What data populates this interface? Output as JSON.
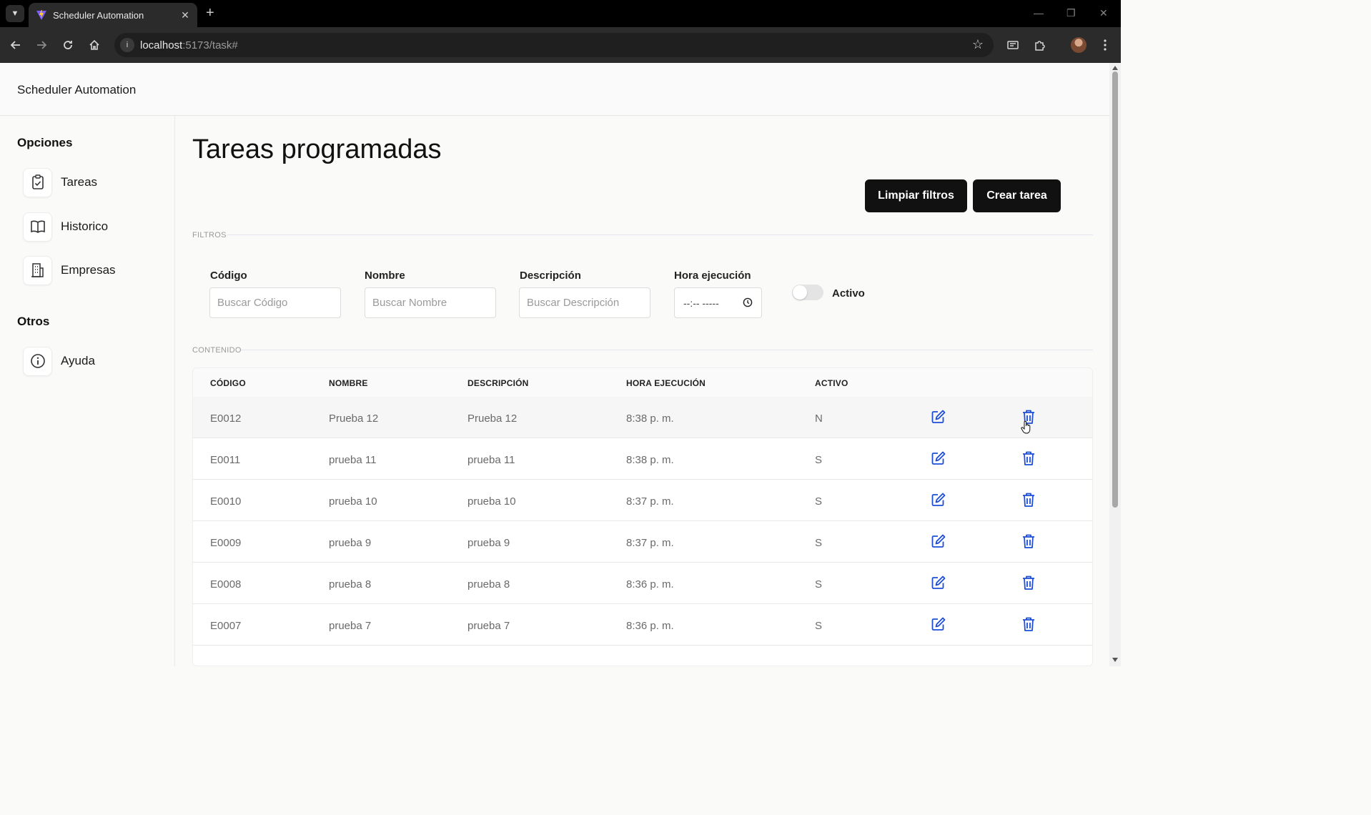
{
  "browser": {
    "tab_title": "Scheduler Automation",
    "url_host": "localhost",
    "url_rest": ":5173/task#"
  },
  "app": {
    "brand": "Scheduler Automation"
  },
  "sidebar": {
    "heading_options": "Opciones",
    "items": [
      {
        "label": "Tareas",
        "icon": "clipboard-check-icon"
      },
      {
        "label": "Historico",
        "icon": "book-icon"
      },
      {
        "label": "Empresas",
        "icon": "building-icon"
      }
    ],
    "heading_other": "Otros",
    "other_items": [
      {
        "label": "Ayuda",
        "icon": "info-icon"
      }
    ]
  },
  "main": {
    "title": "Tareas programadas",
    "clear_filters_label": "Limpiar filtros",
    "create_task_label": "Crear tarea",
    "filters_section": "FILTROS",
    "content_section": "CONTENIDO"
  },
  "filters": {
    "code_label": "Código",
    "code_placeholder": "Buscar Código",
    "name_label": "Nombre",
    "name_placeholder": "Buscar Nombre",
    "desc_label": "Descripción",
    "desc_placeholder": "Buscar Descripción",
    "time_label": "Hora ejecución",
    "time_value": "--:-- -----",
    "active_label": "Activo",
    "active_on": false
  },
  "table": {
    "headers": [
      "CÓDIGO",
      "NOMBRE",
      "DESCRIPCIÓN",
      "HORA EJECUCIÓN",
      "ACTIVO"
    ],
    "rows": [
      [
        "E0012",
        "Prueba 12",
        "Prueba 12",
        "8:38 p. m.",
        "N"
      ],
      [
        "E0011",
        "prueba 11",
        "prueba 11",
        "8:38 p. m.",
        "S"
      ],
      [
        "E0010",
        "prueba 10",
        "prueba 10",
        "8:37 p. m.",
        "S"
      ],
      [
        "E0009",
        "prueba 9",
        "prueba 9",
        "8:37 p. m.",
        "S"
      ],
      [
        "E0008",
        "prueba 8",
        "prueba 8",
        "8:36 p. m.",
        "S"
      ],
      [
        "E0007",
        "prueba 7",
        "prueba 7",
        "8:36 p. m.",
        "S"
      ]
    ]
  },
  "colors": {
    "action_blue": "#1d4ed8",
    "button_dark": "#111111"
  }
}
